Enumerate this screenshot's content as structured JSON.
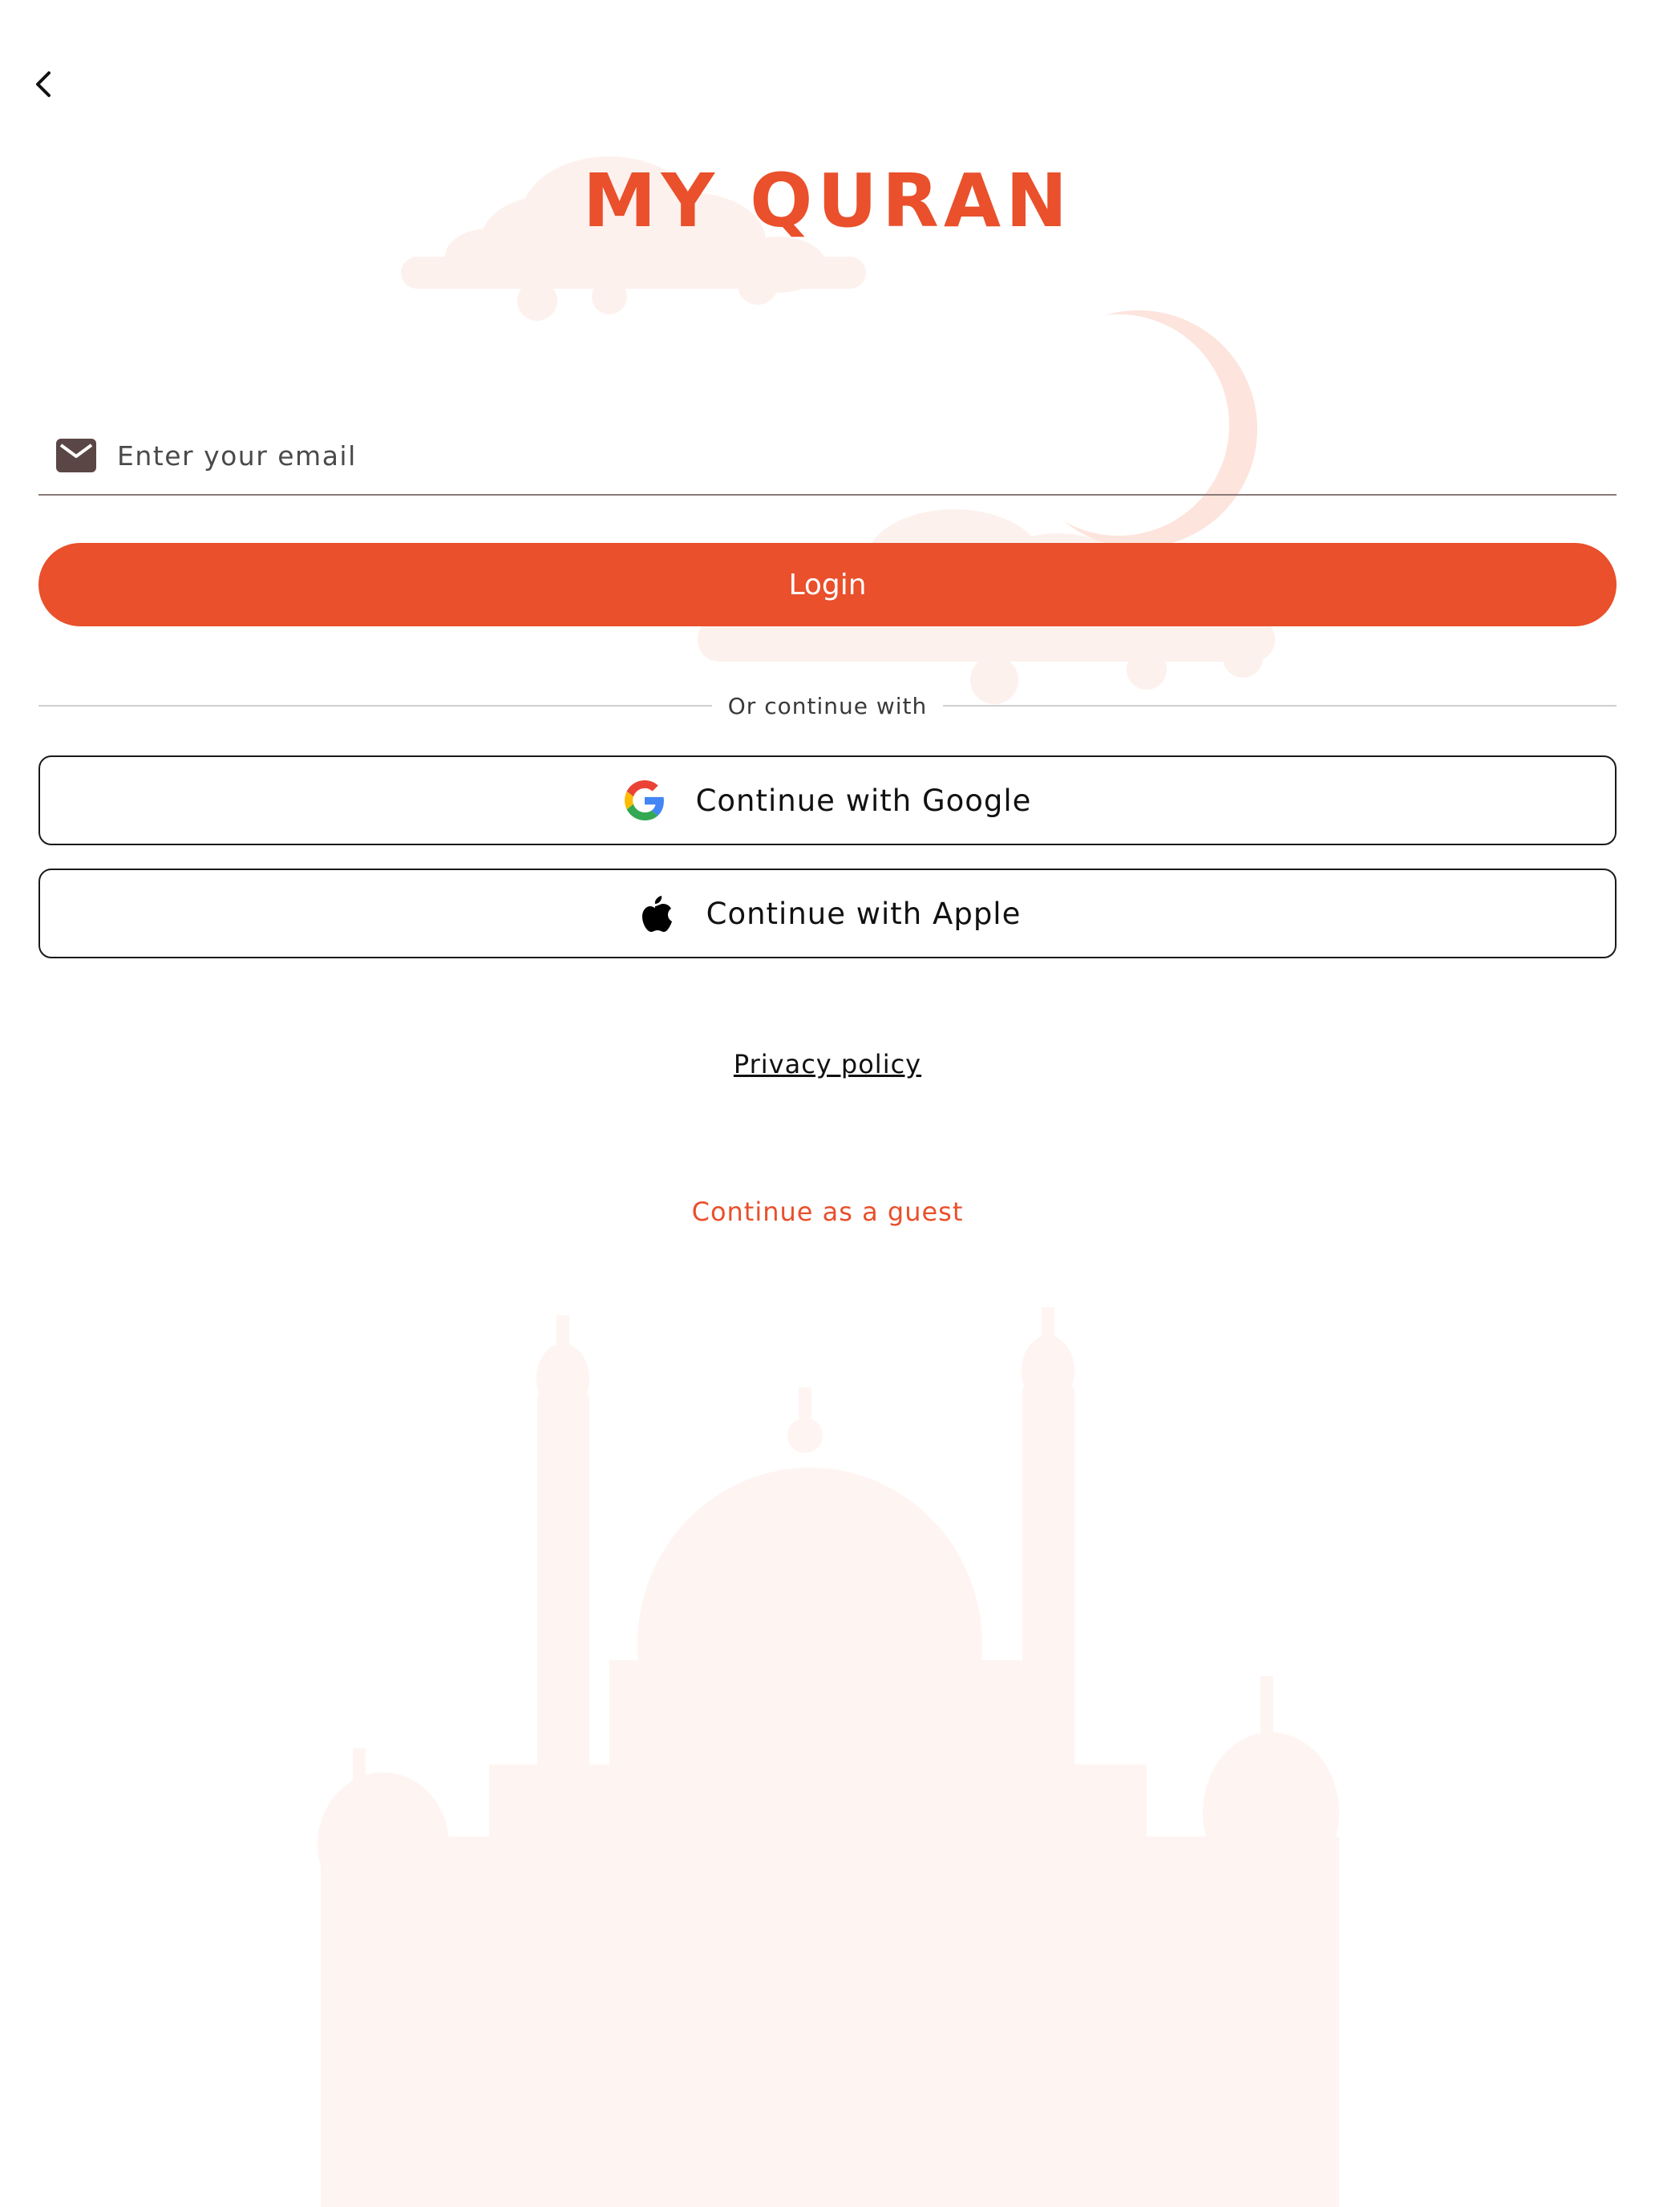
{
  "header": {
    "back_icon": "chevron-left-icon"
  },
  "app": {
    "title": "MY QURAN"
  },
  "form": {
    "email_icon": "mail-icon",
    "email_placeholder": "Enter your email",
    "email_value": "",
    "login_label": "Login"
  },
  "divider": {
    "text": "Or continue with"
  },
  "social": {
    "google_icon": "google-logo-icon",
    "google_label": "Continue with Google",
    "apple_icon": "apple-logo-icon",
    "apple_label": "Continue with Apple"
  },
  "links": {
    "privacy": "Privacy policy",
    "guest": "Continue as a guest"
  },
  "colors": {
    "accent": "#e9502b",
    "decoration": "#fdf1ee",
    "divider": "#cfcfcf",
    "input_underline": "#8a7a78"
  }
}
